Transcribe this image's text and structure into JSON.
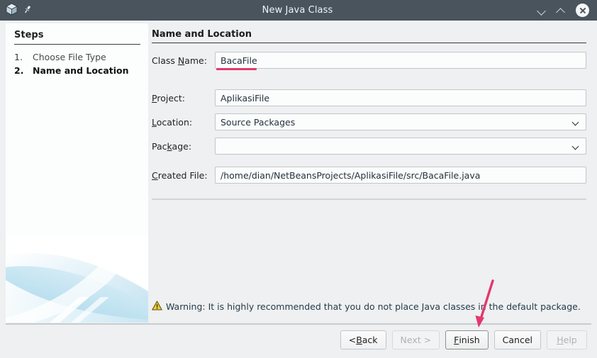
{
  "window": {
    "title": "New Java Class",
    "icons": {
      "app": "cube-icon",
      "pin": "pin-icon",
      "minimize": "chevron-down-icon",
      "maximize": "chevron-up-icon",
      "close": "close-icon"
    }
  },
  "steps": {
    "heading": "Steps",
    "items": [
      {
        "number": "1.",
        "label": "Choose File Type",
        "current": false
      },
      {
        "number": "2.",
        "label": "Name and Location",
        "current": true
      }
    ]
  },
  "main": {
    "section_title": "Name and Location",
    "fields": [
      {
        "label_pre": "Class ",
        "label_mn": "N",
        "label_post": "ame:",
        "value": "BacaFile",
        "type": "text",
        "name": "class-name"
      },
      {
        "label_pre": "",
        "label_mn": "P",
        "label_post": "roject:",
        "value": "AplikasiFile",
        "type": "text",
        "name": "project"
      },
      {
        "label_pre": "",
        "label_mn": "L",
        "label_post": "ocation:",
        "value": "Source Packages",
        "type": "combo",
        "name": "location"
      },
      {
        "label_pre": "Pac",
        "label_mn": "k",
        "label_post": "age:",
        "value": "",
        "type": "combo",
        "name": "package"
      },
      {
        "label_pre": "",
        "label_mn": "C",
        "label_post": "reated File:",
        "value": "/home/dian/NetBeansProjects/AplikasiFile/src/BacaFile.java",
        "type": "text",
        "name": "created-file"
      }
    ],
    "warning": {
      "icon": "warning-icon",
      "text": "Warning: It is highly recommended that you do not place Java classes in the default package."
    }
  },
  "footer": {
    "buttons": [
      {
        "pre": "< ",
        "mn": "B",
        "post": "ack",
        "state": "enabled",
        "name": "back-button"
      },
      {
        "pre": "Next >",
        "mn": "",
        "post": "",
        "state": "disabled",
        "name": "next-button"
      },
      {
        "pre": "",
        "mn": "F",
        "post": "inish",
        "state": "default",
        "name": "finish-button"
      },
      {
        "pre": "Cancel",
        "mn": "",
        "post": "",
        "state": "enabled",
        "name": "cancel-button"
      },
      {
        "pre": "",
        "mn": "H",
        "post": "elp",
        "state": "disabled",
        "name": "help-button"
      }
    ]
  },
  "annotations": {
    "underline_color": "#e4376d",
    "arrow_color": "#e4376d",
    "underline_target": "class-name-value",
    "arrow_target": "finish-button"
  },
  "colors": {
    "titlebar": "#49545c",
    "dialog_bg": "#eef0f1",
    "panel_bg": "#fcfdfd",
    "field_bg": "#fbfcfc",
    "field_border": "#c3c7ca",
    "warning_icon": "#e8c52a"
  }
}
